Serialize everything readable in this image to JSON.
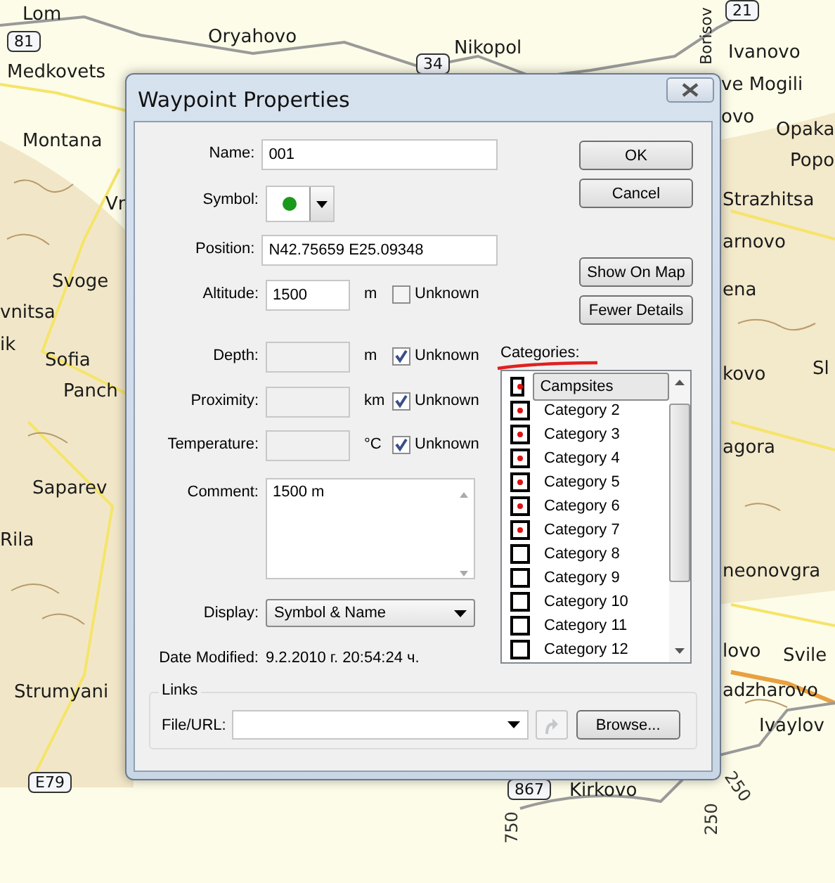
{
  "map": {
    "places": [
      "Lom",
      "Oryahovo",
      "Nikopol",
      "Medkovets",
      "Ivanovo",
      "ve Mogili",
      "ovo",
      "Opaka",
      "Montana",
      "Popo",
      "Strazhitsa",
      "Vr",
      "arnovo",
      "Svoge",
      "ena",
      "vnitsa",
      "ik",
      "Sofia",
      "kovo",
      "Sl",
      "Panch",
      "agora",
      "Saparev",
      "Rila",
      "neonovgra",
      "lovo",
      "Svile",
      "adzharovo",
      "Strumyani",
      "Ivaylov",
      "Kirkovo",
      "Borisov"
    ],
    "road_numbers": [
      "81",
      "34",
      "21",
      "E79",
      "867"
    ],
    "contour_labels": [
      "750",
      "250",
      "250"
    ]
  },
  "dialog": {
    "title": "Waypoint Properties",
    "fields": [
      {
        "kind": "text",
        "label": "Name:",
        "value": "001"
      },
      {
        "kind": "symbol",
        "label": "Symbol:"
      },
      {
        "kind": "text",
        "label": "Position:",
        "value": "N42.75659 E25.09348"
      },
      {
        "kind": "measure",
        "label": "Altitude:",
        "value": "1500",
        "unit": "m",
        "unknown_label": "Unknown",
        "unknown": false
      },
      {
        "kind": "measure",
        "label": "Depth:",
        "unit": "m",
        "unknown_label": "Unknown",
        "unknown": true
      },
      {
        "kind": "measure",
        "label": "Proximity:",
        "unit": "km",
        "unknown_label": "Unknown",
        "unknown": true
      },
      {
        "kind": "measure",
        "label": "Temperature:",
        "unit": "°C",
        "unknown_label": "Unknown",
        "unknown": true
      },
      {
        "kind": "textarea",
        "label": "Comment:",
        "value": "1500 m"
      },
      {
        "kind": "select",
        "label": "Display:",
        "value": "Symbol & Name"
      },
      {
        "kind": "info",
        "label": "Date Modified:",
        "value": "9.2.2010 г. 20:54:24 ч."
      }
    ],
    "buttons": [
      "OK",
      "Cancel",
      "Show On Map",
      "Fewer Details"
    ],
    "categories": {
      "label": "Categories:",
      "items": [
        {
          "label": "Campsites",
          "checked": true,
          "selected": true
        },
        {
          "label": "Category 2",
          "checked": true,
          "selected": false
        },
        {
          "label": "Category 3",
          "checked": true,
          "selected": false
        },
        {
          "label": "Category 4",
          "checked": true,
          "selected": false
        },
        {
          "label": "Category 5",
          "checked": true,
          "selected": false
        },
        {
          "label": "Category 6",
          "checked": true,
          "selected": false
        },
        {
          "label": "Category 7",
          "checked": true,
          "selected": false
        },
        {
          "label": "Category 8",
          "checked": false,
          "selected": false
        },
        {
          "label": "Category 9",
          "checked": false,
          "selected": false
        },
        {
          "label": "Category 10",
          "checked": false,
          "selected": false
        },
        {
          "label": "Category 11",
          "checked": false,
          "selected": false
        },
        {
          "label": "Category 12",
          "checked": false,
          "selected": false
        }
      ]
    },
    "links": {
      "title": "Links",
      "label": "File/URL:",
      "go_disabled": true,
      "button": "Browse..."
    }
  }
}
